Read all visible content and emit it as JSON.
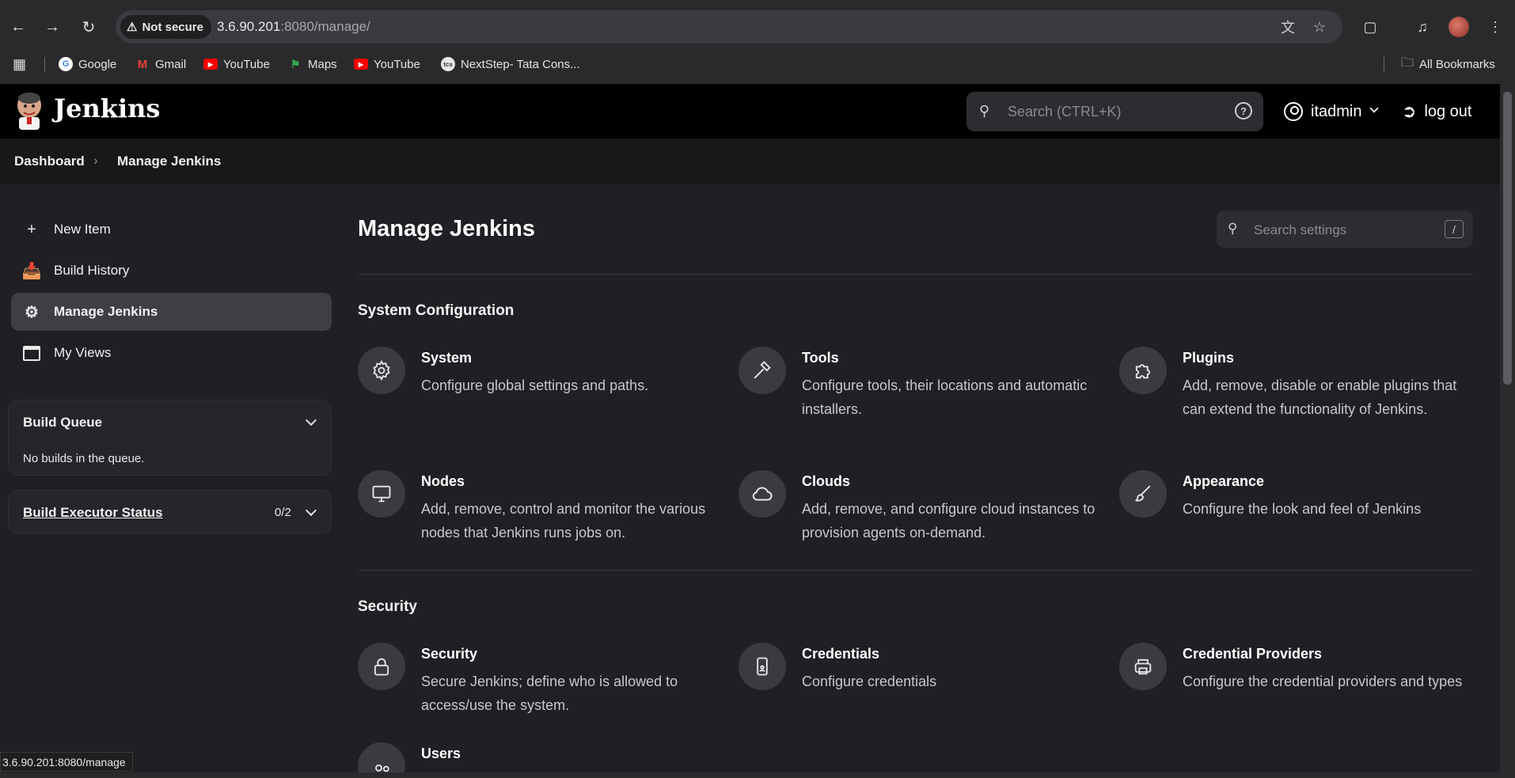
{
  "browser": {
    "security_label": "Not secure",
    "url_host": "3.6.90.201",
    "url_rest": ":8080/manage/",
    "bookmarks": [
      "Google",
      "Gmail",
      "YouTube",
      "Maps",
      "YouTube",
      "NextStep- Tata Cons..."
    ],
    "all_bookmarks": "All Bookmarks",
    "status_url": "3.6.90.201:8080/manage"
  },
  "header": {
    "app_title": "Jenkins",
    "search_placeholder": "Search (CTRL+K)",
    "help_icon": "?",
    "user": "itadmin",
    "logout": "log out"
  },
  "breadcrumb": {
    "items": [
      "Dashboard",
      "Manage Jenkins"
    ]
  },
  "sidebar": {
    "items": [
      {
        "label": "New Item",
        "icon": "plus-icon"
      },
      {
        "label": "Build History",
        "icon": "inbox-icon"
      },
      {
        "label": "Manage Jenkins",
        "icon": "gear-icon"
      },
      {
        "label": "My Views",
        "icon": "window-icon"
      }
    ],
    "build_queue": {
      "title": "Build Queue",
      "empty_text": "No builds in the queue."
    },
    "executor_status": {
      "title": "Build Executor Status",
      "count": "0/2"
    }
  },
  "main": {
    "title": "Manage Jenkins",
    "search_placeholder": "Search settings",
    "search_shortcut": "/",
    "sections": [
      {
        "title": "System Configuration",
        "tiles": [
          {
            "title": "System",
            "desc": "Configure global settings and paths.",
            "icon": "gear-icon"
          },
          {
            "title": "Tools",
            "desc": "Configure tools, their locations and automatic installers.",
            "icon": "hammer-icon"
          },
          {
            "title": "Plugins",
            "desc": "Add, remove, disable or enable plugins that can extend the functionality of Jenkins.",
            "icon": "puzzle-icon"
          },
          {
            "title": "Nodes",
            "desc": "Add, remove, control and monitor the various nodes that Jenkins runs jobs on.",
            "icon": "monitor-icon"
          },
          {
            "title": "Clouds",
            "desc": "Add, remove, and configure cloud instances to provision agents on-demand.",
            "icon": "cloud-icon"
          },
          {
            "title": "Appearance",
            "desc": "Configure the look and feel of Jenkins",
            "icon": "brush-icon"
          }
        ]
      },
      {
        "title": "Security",
        "tiles": [
          {
            "title": "Security",
            "desc": "Secure Jenkins; define who is allowed to access/use the system.",
            "icon": "lock-icon"
          },
          {
            "title": "Credentials",
            "desc": "Configure credentials",
            "icon": "phone-icon"
          },
          {
            "title": "Credential Providers",
            "desc": "Configure the credential providers and types",
            "icon": "printer-icon"
          },
          {
            "title": "Users",
            "desc": "",
            "icon": "users-icon"
          }
        ]
      }
    ]
  }
}
